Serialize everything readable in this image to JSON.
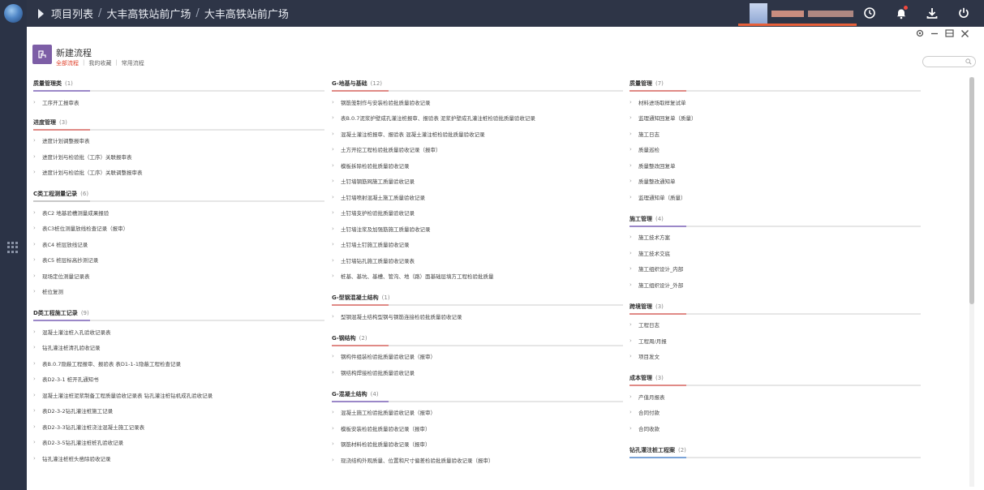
{
  "breadcrumb": [
    "项目列表",
    "大丰高铁站前广场",
    "大丰高铁站前广场"
  ],
  "header": {
    "title": "新建流程",
    "tabs": [
      "全部流程",
      "我的收藏",
      "常用流程"
    ]
  },
  "icons": {
    "clock": "clock-icon",
    "bell": "bell-icon",
    "download": "download-icon",
    "power": "power-icon",
    "settings": "settings-icon",
    "minimize": "minimize-icon",
    "restore": "restore-icon",
    "close": "close-icon",
    "search": "search-icon"
  },
  "colors": {
    "accent": "#e8603a",
    "topbar": "#2e3547",
    "sidebar": "#2b3346",
    "flow_icon": "#7d5ea6"
  },
  "columns": [
    {
      "groups": [
        {
          "title": "质量管理类",
          "count": "(1)",
          "accent": "#9b88c8",
          "items": [
            "工序开工报审表"
          ]
        },
        {
          "title": "进度管理",
          "count": "(3)",
          "accent": "#e08a86",
          "items": [
            "进度计划调整报审表",
            "进度计划与检验批（工序）关联报审表",
            "进度计划与检验批（工序）关联调整报审表"
          ]
        },
        {
          "title": "C类工程测量记录",
          "count": "(6)",
          "accent": "#c8c8c8",
          "items": [
            "表C2 地基验槽测量成果报验",
            "表C3桩位测量放线检查记录（报审）",
            "表C4 桩层放线记录",
            "表C5 桩层标高抄测记录",
            "现场定位测量记录表",
            "桩位复测"
          ]
        },
        {
          "title": "D类工程施工记录",
          "count": "(9)",
          "accent": "#9b88c8",
          "items": [
            "混凝土灌注桩入孔验收记录表",
            "钻孔灌注桩清孔验收记录",
            "表B.0.7隐蔽工程报审、报验表 表D1-1-1隐蔽工程检查记录",
            "表D2-3-1 桩开孔通知书",
            "混凝土灌注桩泥浆制备工程质量验收记录表 钻孔灌注桩钻机成孔验收记录",
            "表D2-3-2钻孔灌注桩施工记录",
            "表D2-3-3钻孔灌注桩浇注混凝土施工记录表",
            "表D2-3-5钻孔灌注桩桩孔验收记录",
            "钻孔灌注桩桩头凿除验收记录"
          ]
        }
      ]
    },
    {
      "groups": [
        {
          "title": "G-地基与基础",
          "count": "(12)",
          "accent": "#e08a86",
          "items": [
            "钢筋笼制作与安装检验批质量验收记录",
            "表B.0.7泥浆护壁成孔灌注桩报审、报验表 泥浆护壁成孔灌注桩检验批质量验收记录",
            "混凝土灌注桩报审、报验表 混凝土灌注桩检验批质量验收记录",
            "土方开挖工程检验批质量验收记录（报审）",
            "模板拆除检验批质量验收记录",
            "土钉墙钢筋网施工质量验收记录",
            "土钉墙喷射混凝土施工质量验收记录",
            "土钉墙支护检验批质量验收记录",
            "土钉墙注浆及加强筋施工质量验收记录",
            "土钉墙土钉施工质量验收记录",
            "土钉墙钻孔施工质量验收记录表",
            "桩基、基坑、基槽、管沟、地（路）面基础层填方工程检验批质量"
          ]
        },
        {
          "title": "G-型钢混凝土结构",
          "count": "(1)",
          "accent": "#e08a86",
          "items": [
            "型钢混凝土结构型钢与钢筋连接检验批质量验收记录"
          ]
        },
        {
          "title": "G-钢结构",
          "count": "(2)",
          "accent": "#e08a86",
          "items": [
            "钢构件组装检验批质量验收记录（报审）",
            "钢结构焊接检验批质量验收记录"
          ]
        },
        {
          "title": "G-混凝土结构",
          "count": "(4)",
          "accent": "#9b88c8",
          "items": [
            "混凝土施工检验批质量验收记录（报审）",
            "模板安装检验批质量验收记录（报审）",
            "钢筋材料检验批质量验收记录（报审）",
            "现浇结构外观质量、位置和尺寸偏差检验批质量验收记录（报审）"
          ]
        }
      ]
    },
    {
      "groups": [
        {
          "title": "质量管理",
          "count": "(7)",
          "accent": "#e08a86",
          "items": [
            "材料进场取样复试单",
            "监理通知回复单（质量）",
            "施工日志",
            "质量巡检",
            "质量整改回复单",
            "质量整改通知单",
            "监理通知单（质量）"
          ]
        },
        {
          "title": "施工管理",
          "count": "(4)",
          "accent": "#9b88c8",
          "items": [
            "施工技术方案",
            "施工技术交底",
            "施工组织设计_内部",
            "施工组织设计_外部"
          ]
        },
        {
          "title": "跨境管理",
          "count": "(3)",
          "accent": "#e08a86",
          "items": [
            "工程日志",
            "工程周/月报",
            "项目发文"
          ]
        },
        {
          "title": "成本管理",
          "count": "(3)",
          "accent": "#e08a86",
          "items": [
            "产值月报表",
            "合同付款",
            "合同收款"
          ]
        },
        {
          "title": "钻孔灌注桩工程案",
          "count": "(2)",
          "accent": "#7ba4d8",
          "items": []
        }
      ]
    }
  ]
}
